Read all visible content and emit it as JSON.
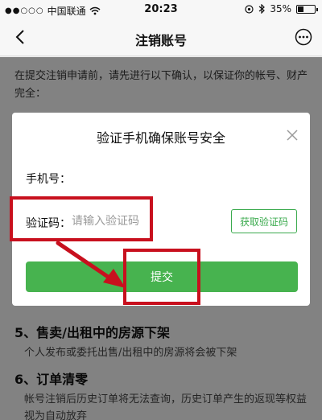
{
  "status_bar": {
    "signal": "●●○○○",
    "carrier": "中国联通",
    "time": "20:23",
    "battery": "35%",
    "battery_level": 0.35
  },
  "nav": {
    "title": "注销账号"
  },
  "intro": {
    "text": "在提交注销申请前，请先进行以下确认，以保证你的帐号、财产完全："
  },
  "dialog": {
    "title": "验证手机确保账号安全",
    "phone_label": "手机号：",
    "code_label": "验证码：",
    "code_placeholder": "请输入验证码",
    "get_code_label": "获取验证码",
    "submit_label": "提交"
  },
  "sections": [
    {
      "heading": "5、售卖/出租中的房源下架",
      "desc": "个人发布或委托出售/出租中的房源将会被下架"
    },
    {
      "heading": "6、订单清零",
      "desc": "帐号注销后历史订单将无法查询，历史订单产生的返现等权益视为自动放弃"
    }
  ],
  "colors": {
    "accent_green": "#47b34f",
    "highlight_red": "#c8101e"
  }
}
